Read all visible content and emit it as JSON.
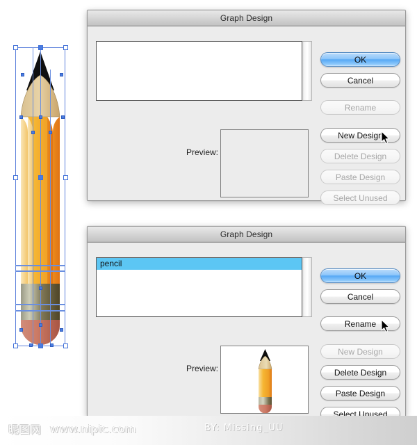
{
  "window": {
    "title": "Graph Design"
  },
  "dialog1": {
    "title": "Graph Design",
    "listbox": {
      "items": [],
      "scrollbar": "vertical-scrollbar"
    },
    "preview": {
      "label": "Preview:",
      "content": ""
    },
    "buttons": [
      {
        "label": "OK",
        "state": "default",
        "name": "ok-button"
      },
      {
        "label": "Cancel",
        "state": "enabled",
        "name": "cancel-button"
      },
      {
        "label": "Rename",
        "state": "disabled",
        "name": "rename-button"
      },
      {
        "label": "New Design",
        "state": "enabled",
        "name": "new-design-button"
      },
      {
        "label": "Delete Design",
        "state": "disabled",
        "name": "delete-design-button"
      },
      {
        "label": "Paste Design",
        "state": "disabled",
        "name": "paste-design-button"
      },
      {
        "label": "Select Unused",
        "state": "disabled",
        "name": "select-unused-button"
      }
    ],
    "cursor_over": "New Design"
  },
  "dialog2": {
    "title": "Graph Design",
    "listbox": {
      "items": [
        "pencil"
      ],
      "selected": "pencil",
      "selection_color": "#5cc6f4",
      "scrollbar": "vertical-scrollbar"
    },
    "preview": {
      "label": "Preview:",
      "content": "pencil-thumbnail"
    },
    "buttons": [
      {
        "label": "OK",
        "state": "default",
        "name": "ok-button"
      },
      {
        "label": "Cancel",
        "state": "enabled",
        "name": "cancel-button"
      },
      {
        "label": "Rename",
        "state": "enabled",
        "name": "rename-button"
      },
      {
        "label": "New Design",
        "state": "disabled",
        "name": "new-design-button"
      },
      {
        "label": "Delete Design",
        "state": "enabled",
        "name": "delete-design-button"
      },
      {
        "label": "Paste Design",
        "state": "enabled",
        "name": "paste-design-button"
      },
      {
        "label": "Select Unused",
        "state": "enabled",
        "name": "select-unused-button"
      }
    ],
    "cursor_over": "Rename"
  },
  "artwork": {
    "name": "pencil-illustration",
    "selected": true,
    "colors": {
      "tip": "#121212",
      "wood_light": "#e3cfa4",
      "wood_dark": "#c9a468",
      "body_light": "#f7d58b",
      "body_mid": "#f0a02a",
      "body_dark": "#e07a18",
      "ferrule_light": "#b9b9a0",
      "ferrule_dark": "#5d5434",
      "eraser": "#c9705c",
      "selection": "#4a7ce0"
    }
  },
  "watermark": {
    "logo": "昵图网",
    "url": "www.nipic.com",
    "credit": "BY: Missing_UU"
  }
}
